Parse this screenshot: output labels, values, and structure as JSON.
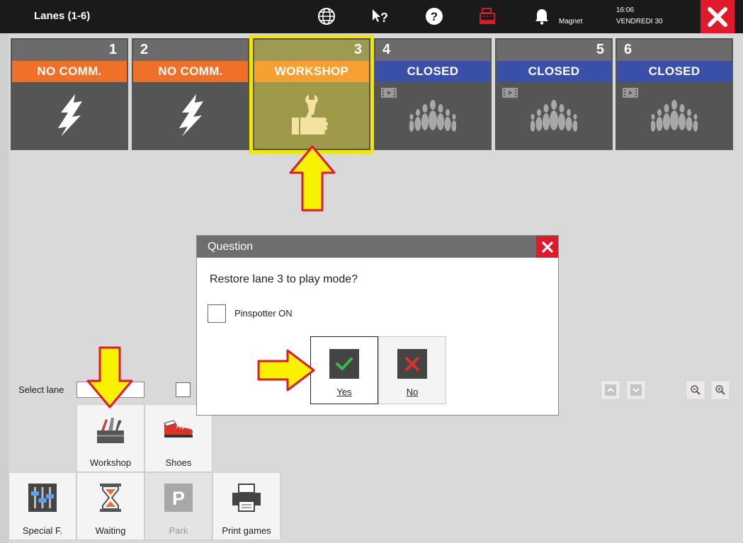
{
  "window": {
    "title": "Lanes (1-6)",
    "user": "Magnet",
    "time": "16:06",
    "date": "VENDREDI 30"
  },
  "colors": {
    "no_comm": "#f07028",
    "workshop": "#f5a030",
    "closed": "#3a4fa8",
    "selected_outline": "#f2e500",
    "close_red": "#e0192b"
  },
  "lanes": [
    {
      "number": "1",
      "status": "NO COMM.",
      "icon": "lightning-icon"
    },
    {
      "number": "2",
      "status": "NO COMM.",
      "icon": "lightning-icon"
    },
    {
      "number": "3",
      "status": "WORKSHOP",
      "icon": "thumbs-up-wrench-icon"
    },
    {
      "number": "4",
      "status": "CLOSED",
      "icon": "bowling-pins-icon"
    },
    {
      "number": "5",
      "status": "CLOSED",
      "icon": "bowling-pins-icon"
    },
    {
      "number": "6",
      "status": "CLOSED",
      "icon": "bowling-pins-icon"
    }
  ],
  "dialog": {
    "title": "Question",
    "question": "Restore lane 3 to play mode?",
    "checkbox_label": "Pinspotter ON",
    "yes_label": "Yes",
    "no_label": "No"
  },
  "select_lane": {
    "label": "Select lane",
    "value": ""
  },
  "tiles": {
    "workshop": "Workshop",
    "shoes": "Shoes",
    "special": "Special F.",
    "waiting": "Waiting",
    "park": "Park",
    "print": "Print games"
  }
}
